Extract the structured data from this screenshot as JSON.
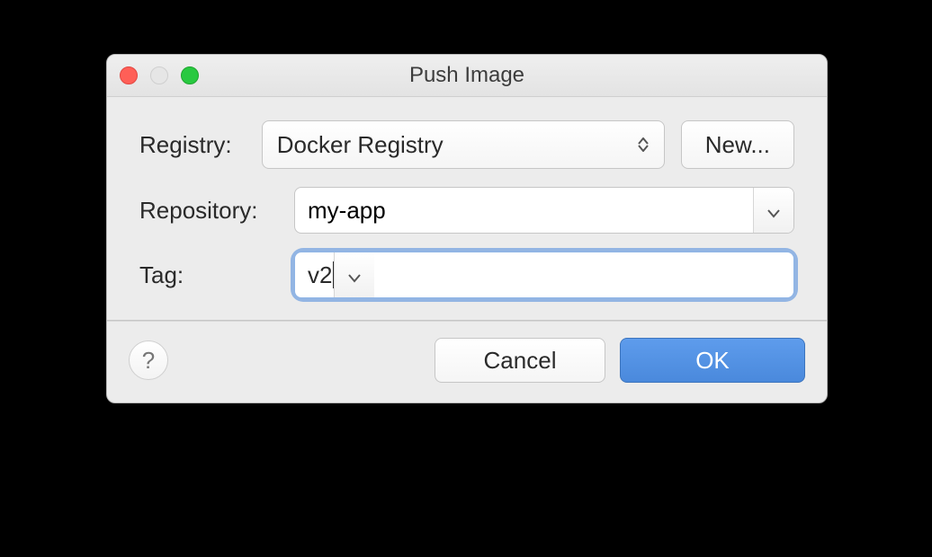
{
  "window": {
    "title": "Push Image"
  },
  "form": {
    "registry": {
      "label": "Registry:",
      "selected": "Docker Registry",
      "new_button": "New..."
    },
    "repository": {
      "label": "Repository:",
      "value": "my-app"
    },
    "tag": {
      "label": "Tag:",
      "value": "v2"
    }
  },
  "footer": {
    "help": "?",
    "cancel": "Cancel",
    "ok": "OK"
  },
  "colors": {
    "accent": "#4a89dc",
    "window_bg": "#ececec"
  }
}
